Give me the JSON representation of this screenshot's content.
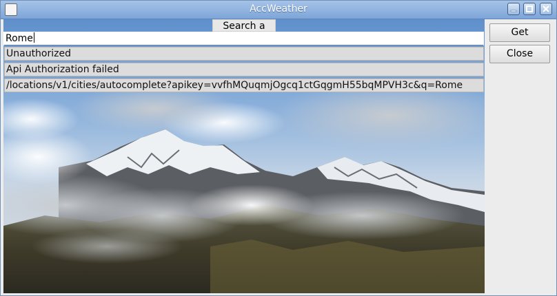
{
  "window": {
    "title": "AccWeather"
  },
  "search": {
    "label": "Search a city!",
    "value": "Rome"
  },
  "results": [
    "Unauthorized",
    "Api Authorization failed",
    "/locations/v1/cities/autocomplete?apikey=vvfhMQuqmjOgcq1ctGqgmH55bqMPVH3c&q=Rome"
  ],
  "buttons": {
    "get_weather": "Get Weather",
    "close": "Close"
  },
  "icons": {
    "app": "app-icon",
    "minimize": "minimize-icon",
    "maximize": "maximize-icon",
    "close": "close-icon"
  },
  "colors": {
    "titlebar": "#8fb2de",
    "accent": "#6b8fc4",
    "field_bg": "#dcdcdc"
  }
}
